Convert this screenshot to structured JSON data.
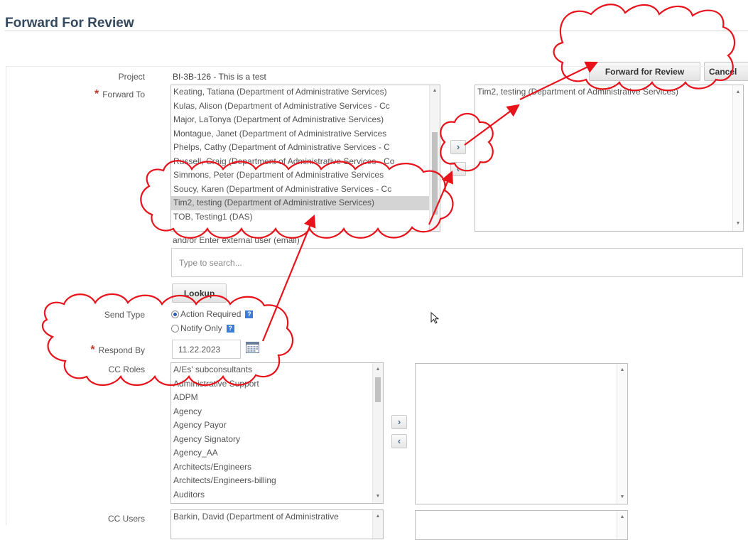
{
  "header": {
    "title": "Forward For Review"
  },
  "toolbar": {
    "forward_label": "Forward for Review",
    "cancel_label": "Cancel"
  },
  "form": {
    "project": {
      "label": "Project",
      "value": "BI-3B-126 - This is a test"
    },
    "forward_to": {
      "label": "Forward To",
      "available": [
        "Keating, Tatiana (Department of Administrative Services)",
        "Kulas, Alison (Department of Administrative Services - Cc",
        "Major, LaTonya (Department of Administrative Services)",
        "Montague, Janet (Department of Administrative Services",
        "Phelps, Cathy (Department of Administrative Services - C",
        "Russell, Craig (Department of Administrative Services - Co",
        "Simmons, Peter (Department of Administrative Services",
        "Soucy, Karen (Department of Administrative Services - Cc",
        "Tim2, testing (Department of Administrative Services)",
        "TOB, Testing1 (DAS)"
      ],
      "selected_index": 8,
      "chosen": [
        "Tim2, testing (Department of Administrative Services)"
      ]
    },
    "external_user": {
      "label": "and/or Enter external user (email)",
      "placeholder": "Type to search...",
      "lookup_label": "Lookup"
    },
    "send_type": {
      "label": "Send Type",
      "options": [
        "Action Required",
        "Notify Only"
      ],
      "selected": "Action Required"
    },
    "respond_by": {
      "label": "Respond By",
      "value": "11.22.2023"
    },
    "cc_roles": {
      "label": "CC Roles",
      "available": [
        "A/Es' subconsultants",
        "Administrative Support",
        "ADPM",
        "Agency",
        "Agency Payor",
        "Agency Signatory",
        "Agency_AA",
        "Architects/Engineers",
        "Architects/Engineers-billing",
        "Auditors"
      ],
      "chosen": []
    },
    "cc_users": {
      "label": "CC Users",
      "available": [
        "Barkin, David (Department of Administrative"
      ]
    }
  },
  "icons": {
    "move_right": "chevron-right-icon",
    "move_left": "chevron-left-icon",
    "calendar": "calendar-icon",
    "info": "info-icon"
  },
  "colors": {
    "annotation": "#e8121b",
    "required": "#c0392b",
    "title": "#34495e"
  }
}
